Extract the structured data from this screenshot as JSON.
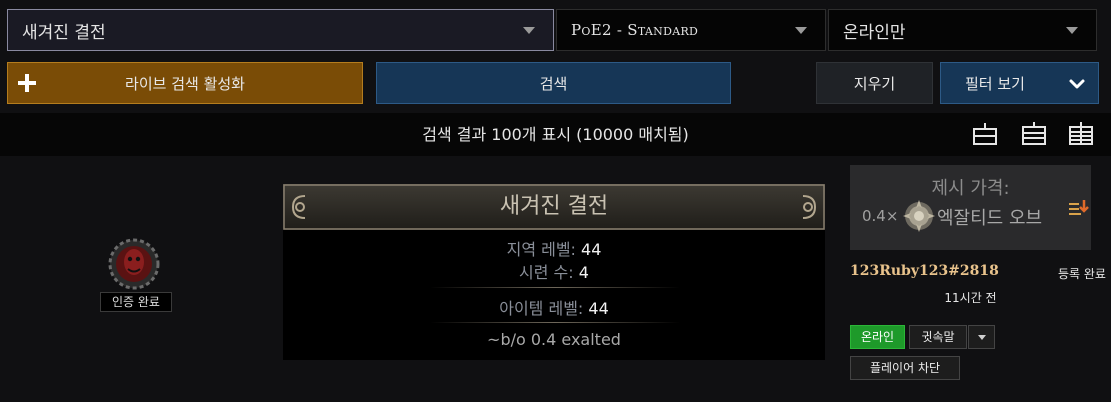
{
  "search": {
    "item_select": "새겨진 결전",
    "league_select": "PoE2 - Standard",
    "status_select": "온라인만"
  },
  "buttons": {
    "live_search": "라이브 검색 활성화",
    "search": "검색",
    "clear": "지우기",
    "show_filters": "필터 보기"
  },
  "results": {
    "summary": "검색 결과 100개 표시 (10000 매치됨)"
  },
  "listing": {
    "verified_label": "인증 완료",
    "item": {
      "name": "새겨진 결전",
      "area_level_label": "지역 레벨:",
      "area_level_value": "44",
      "trials_label": "시련 수:",
      "trials_value": "4",
      "item_level_label": "아이템 레벨:",
      "item_level_value": "44",
      "note": "~b/o 0.4 exalted"
    },
    "price": {
      "label": "제시 가격:",
      "multiplier": "0.4×",
      "currency": "엑잘티드 오브"
    },
    "seller": {
      "account": "123Ruby123#2818",
      "listed_label": "등록 완료",
      "time_ago": "11시간 전"
    },
    "actions": {
      "online": "온라인",
      "whisper": "귓속말",
      "block": "플레이어 차단"
    }
  },
  "colors": {
    "live_button": "#7a4c06",
    "primary_button": "#163656",
    "online_status": "#1e9a2a",
    "seller_name": "#e9c38c"
  }
}
